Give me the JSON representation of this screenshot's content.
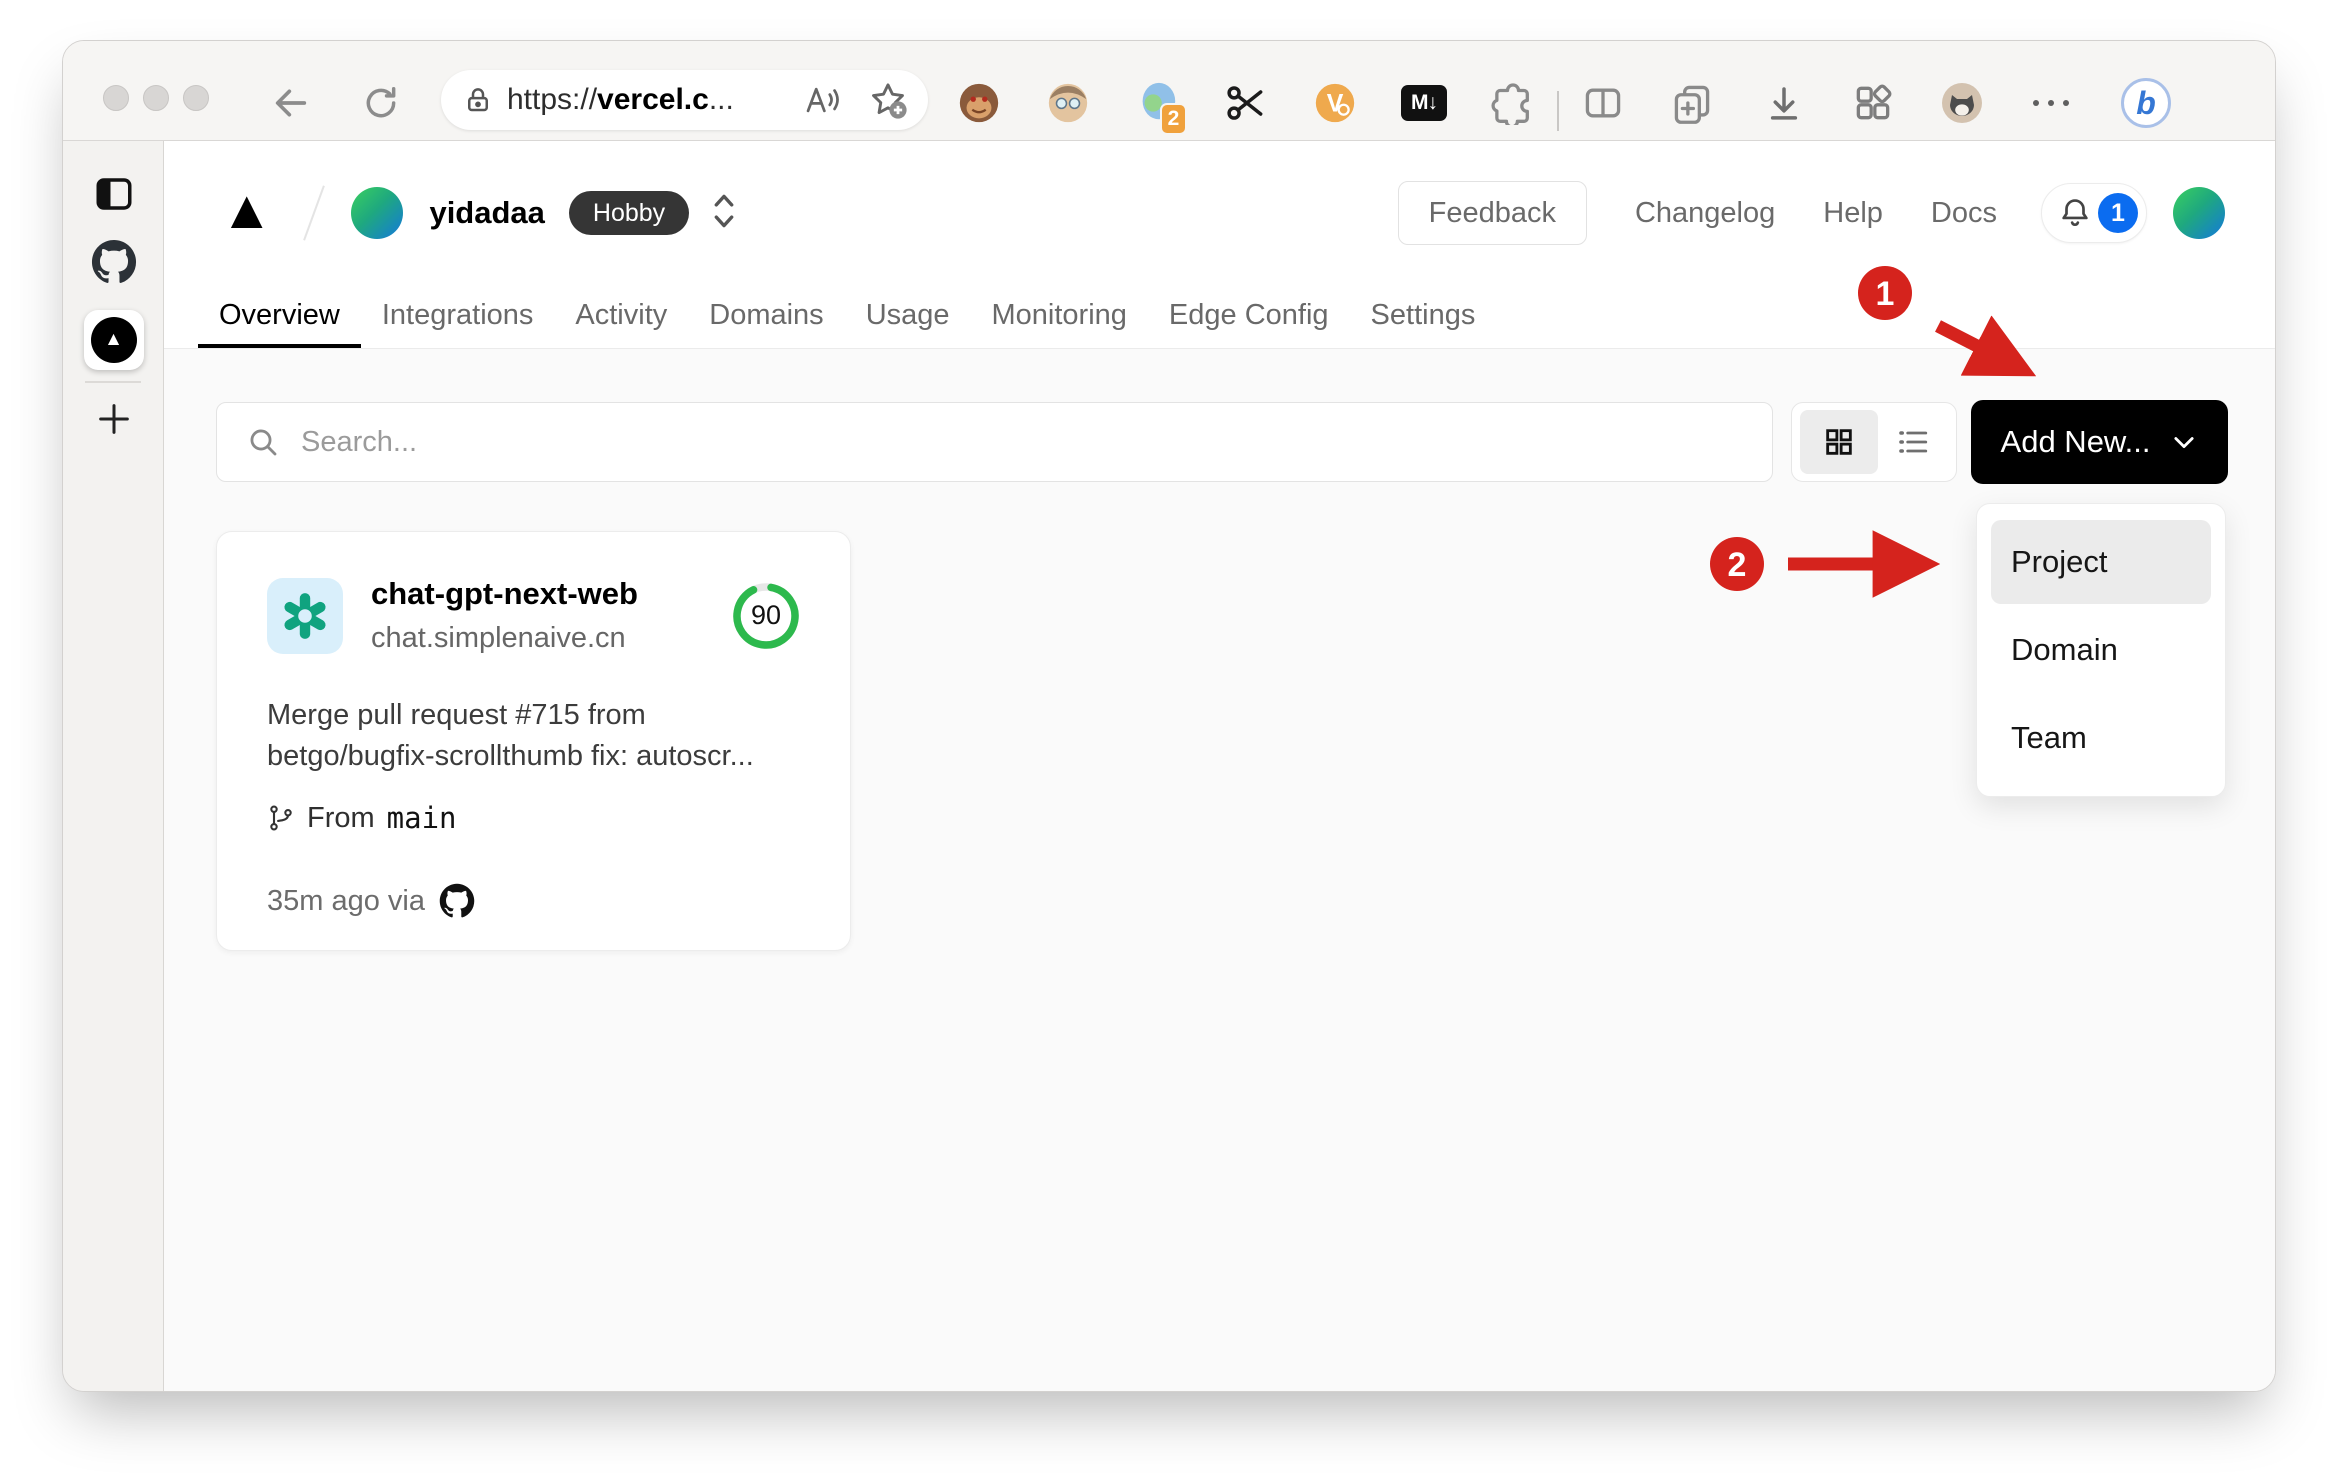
{
  "browser": {
    "url_scheme": "https://",
    "url_host": "vercel.c",
    "url_suffix": "...",
    "ext_badge": "2",
    "markdown_label": "M↓",
    "video_label": "V",
    "bing_label": "b"
  },
  "header": {
    "team_name": "yidadaa",
    "plan": "Hobby",
    "feedback": "Feedback",
    "changelog": "Changelog",
    "help": "Help",
    "docs": "Docs",
    "notification_count": "1"
  },
  "nav": {
    "tabs": [
      "Overview",
      "Integrations",
      "Activity",
      "Domains",
      "Usage",
      "Monitoring",
      "Edge Config",
      "Settings"
    ],
    "active_tab": "Overview"
  },
  "content": {
    "search_placeholder": "Search...",
    "add_new": "Add New..."
  },
  "dropdown": {
    "items": [
      "Project",
      "Domain",
      "Team"
    ],
    "highlighted": "Project"
  },
  "card": {
    "name": "chat-gpt-next-web",
    "domain": "chat.simplenaive.cn",
    "score": "90",
    "commit_line1": "Merge pull request #715 from",
    "commit_line2": "betgo/bugfix-scrollthumb fix: autoscr...",
    "from_label": "From",
    "branch": "main",
    "time": "35m ago via"
  },
  "annotations": {
    "step1": "1",
    "step2": "2"
  },
  "colors": {
    "annotation_red": "#d5231d",
    "button_black": "#000000",
    "notification_blue": "#0b6cf0",
    "score_green": "#2db94d",
    "openai_teal": "#10a37f",
    "plan_badge_bg": "#353535",
    "content_bg": "#fafafa"
  }
}
